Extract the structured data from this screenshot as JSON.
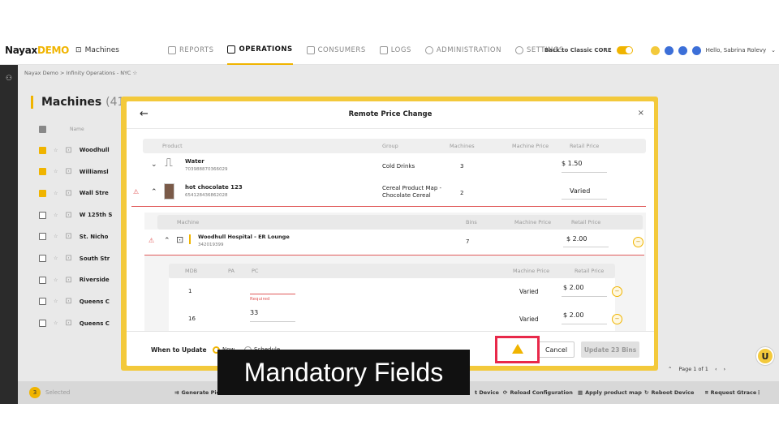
{
  "app": {
    "brand": "Nayax",
    "brand_suffix": "DEMO",
    "section": "Machines"
  },
  "nav": {
    "items": [
      {
        "label": "REPORTS",
        "active": false
      },
      {
        "label": "OPERATIONS",
        "active": true
      },
      {
        "label": "CONSUMERS",
        "active": false
      },
      {
        "label": "LOGS",
        "active": false
      },
      {
        "label": "ADMINISTRATION",
        "active": false
      },
      {
        "label": "SETTINGS",
        "active": false
      }
    ],
    "back_to": "Back to Classic CORE",
    "greeting": "Hello, Sabrina Rolevy"
  },
  "breadcrumb": {
    "org": "Nayax Demo",
    "sep": ">",
    "path": "Infinity Operations - NYC",
    "star": "☆"
  },
  "page": {
    "title": "Machines",
    "count": "(41)"
  },
  "machine_list": [
    {
      "name": "Woodhull",
      "checked": true
    },
    {
      "name": "Williamsl",
      "checked": true
    },
    {
      "name": "Wall Stre",
      "checked": true
    },
    {
      "name": "W 125th S",
      "checked": false
    },
    {
      "name": "St. Nicho",
      "checked": false
    },
    {
      "name": "South Str",
      "checked": false
    },
    {
      "name": "Riverside",
      "checked": false
    },
    {
      "name": "Queens C",
      "checked": false
    },
    {
      "name": "Queens C",
      "checked": false
    }
  ],
  "list_header": {
    "name": "Name"
  },
  "footer": {
    "selected_count": "3",
    "selected_label": "Selected",
    "actions": [
      "Generate Pic",
      "t Device",
      "Reload Configuration",
      "Apply product map",
      "Reboot Device",
      "Request Gtrace"
    ],
    "pagination": "Page 1 of 1"
  },
  "modal": {
    "title": "Remote Price Change",
    "back": "←",
    "close": "×",
    "product_headers": {
      "product": "Product",
      "group": "Group",
      "machines": "Machines",
      "machine_price": "Machine Price",
      "retail_price": "Retail Price"
    },
    "products": [
      {
        "name": "Water",
        "code": "703988870366029",
        "group": "Cold Drinks",
        "machines": "3",
        "retail_price": "$ 1.50"
      },
      {
        "name": "hot chocolate 123",
        "code": "654128436862028",
        "group": "Cereal Product Map - Chocolate Cereal",
        "machines": "2",
        "retail_price": "Varied"
      }
    ],
    "machine_headers": {
      "machine": "Machine",
      "bins": "Bins",
      "machine_price": "Machine Price",
      "retail_price": "Retail Price"
    },
    "machine_row": {
      "name": "Woodhull Hospital - ER Lounge",
      "code": "342019399",
      "bins": "7",
      "retail_price": "$ 2.00"
    },
    "bin_headers": {
      "mdb": "MDB",
      "pa": "PA",
      "pc": "PC",
      "machine_price": "Machine Price",
      "retail_price": "Retail Price"
    },
    "bins": [
      {
        "mdb": "1",
        "pc": "",
        "pc_error": "Required",
        "machine_price": "Varied",
        "retail_price": "$ 2.00"
      },
      {
        "mdb": "16",
        "pc": "33",
        "pc_error": "",
        "machine_price": "Varied",
        "retail_price": "$ 2.00"
      }
    ],
    "when_label": "When to Update",
    "options": [
      "Now",
      "Schedule"
    ],
    "cancel": "Cancel",
    "update": "Update 23 Bins"
  },
  "caption": "Mandatory Fields",
  "colors": {
    "accent": "#f0b400",
    "highlight": "#e8294a",
    "error": "#e05a5a"
  }
}
